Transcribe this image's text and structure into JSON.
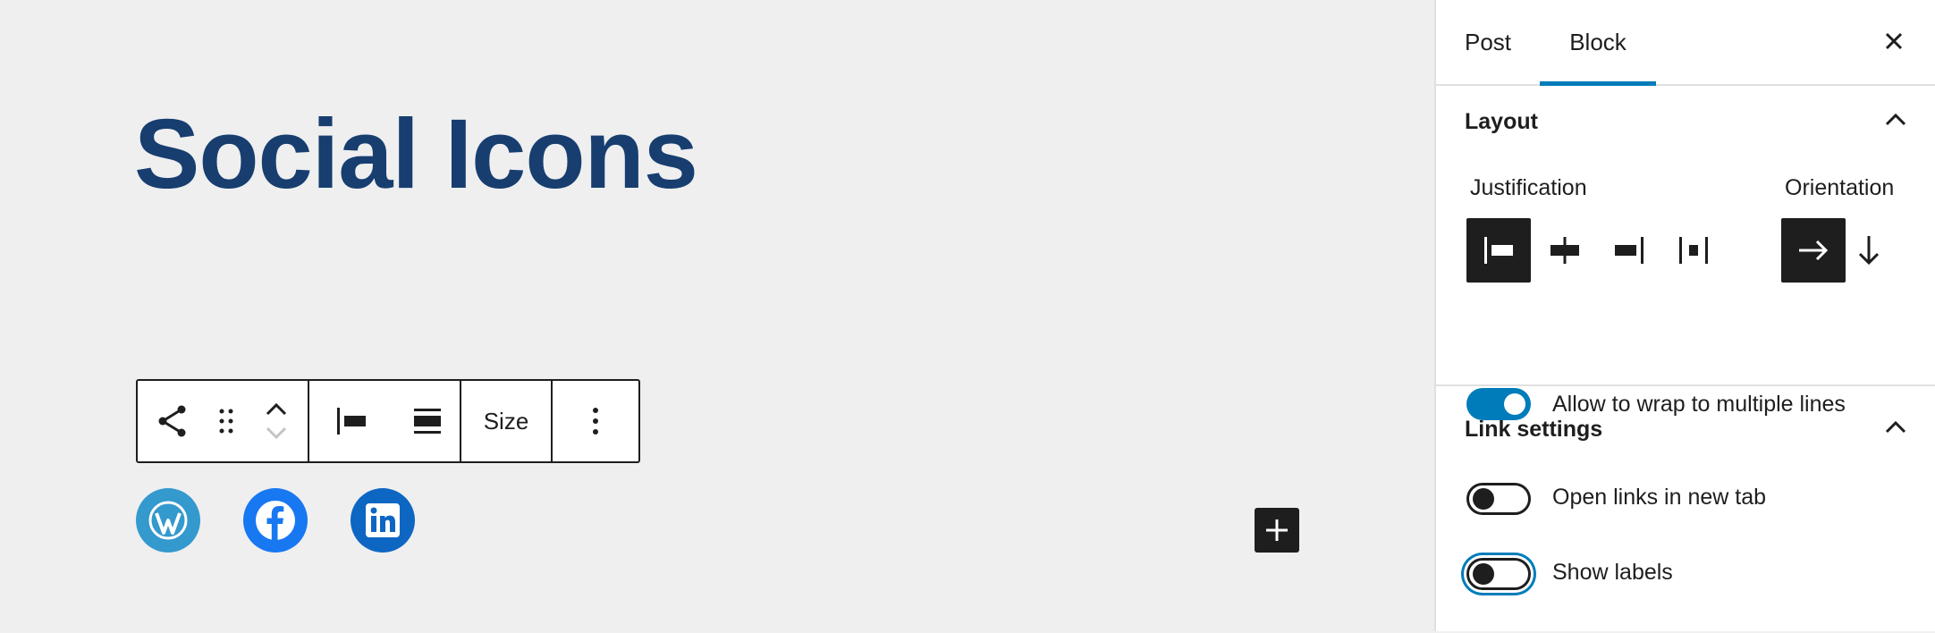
{
  "canvas": {
    "heading": "Social Icons",
    "toolbar": {
      "size_label": "Size",
      "icons": [
        "share-icon",
        "drag-handle-icon",
        "move-up-icon",
        "move-down-icon",
        "justify-left-icon",
        "full-width-icon",
        "more-options-icon"
      ]
    },
    "social_links": [
      {
        "name": "WordPress",
        "color": "#3499cd"
      },
      {
        "name": "Facebook",
        "color": "#1778f2"
      },
      {
        "name": "LinkedIn",
        "color": "#0d66c2"
      }
    ],
    "add_block_icon": "plus-icon"
  },
  "sidebar": {
    "tabs": [
      {
        "label": "Post",
        "active": false
      },
      {
        "label": "Block",
        "active": true
      }
    ],
    "close_icon": "close-icon",
    "layout": {
      "title": "Layout",
      "justification_label": "Justification",
      "orientation_label": "Orientation",
      "justification_selected": "left",
      "orientation_selected": "horizontal",
      "wrap_label": "Allow to wrap to multiple lines",
      "wrap_on": true
    },
    "link_settings": {
      "title": "Link settings",
      "new_tab_label": "Open links in new tab",
      "new_tab_on": false,
      "show_labels_label": "Show labels",
      "show_labels_on": false
    }
  },
  "colors": {
    "heading": "#173e6f",
    "accent": "#007cba",
    "dark": "#1e1e1e"
  }
}
